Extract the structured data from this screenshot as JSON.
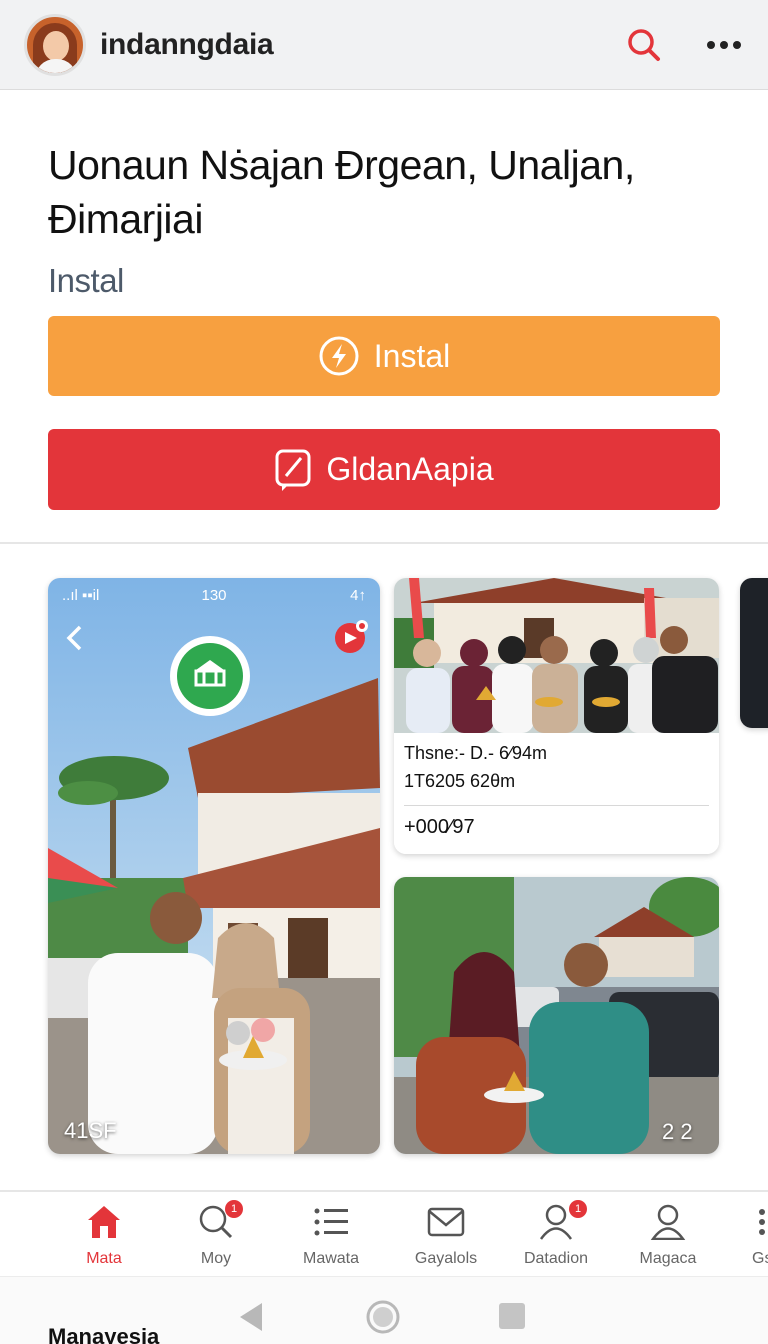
{
  "header": {
    "username": "indanngdaia",
    "search_icon": "search-icon",
    "more_icon": "more-dots-icon"
  },
  "hero": {
    "headline": "Uonaun Nṡajan Ðrgean, Unaljan, Ðimarjiai",
    "subtitle": "Instal"
  },
  "buttons": {
    "install_label": "Instal",
    "second_label": "GldanAapia"
  },
  "feed": {
    "main_card": {
      "status_left": "..ıl ▪▪il",
      "status_time": "130",
      "status_right": "4↑",
      "overlay_text": "41SF"
    },
    "card_a": {
      "line1": "Thsne:- D.- 6⁄94m",
      "line2": "1T6205 62θm",
      "value": "+000⁄97"
    },
    "card_b": {
      "overlay_text": "2 2"
    }
  },
  "nav": {
    "items": [
      {
        "label": "Mata",
        "icon": "home-icon",
        "active": true
      },
      {
        "label": "Moy",
        "icon": "search-icon",
        "badge": "1"
      },
      {
        "label": "Mawata",
        "icon": "list-icon"
      },
      {
        "label": "Gayalols",
        "icon": "mail-icon"
      },
      {
        "label": "Datadion",
        "icon": "profile-icon",
        "badge": "1"
      },
      {
        "label": "Magaca",
        "icon": "user-icon"
      },
      {
        "label": "Gs",
        "icon": "more-icon"
      }
    ]
  },
  "system": {
    "bottom_label": "Manayesia"
  },
  "colors": {
    "accent_red": "#e3353a",
    "accent_orange": "#f7a040"
  }
}
